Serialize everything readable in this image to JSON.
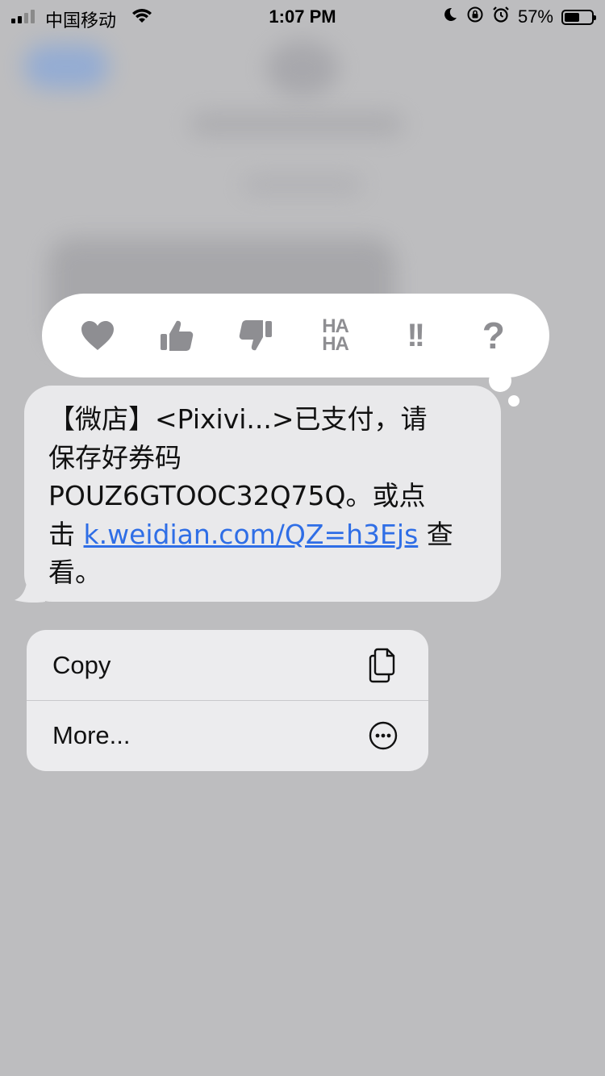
{
  "status_bar": {
    "carrier": "中国移动",
    "time": "1:07 PM",
    "battery_percent": "57%",
    "battery_level": 0.57,
    "signal_bars_active": 2,
    "icons": [
      "wifi-icon",
      "moon-icon",
      "orientation-lock-icon",
      "alarm-icon",
      "battery-icon"
    ]
  },
  "tapback": {
    "options": [
      {
        "name": "heart",
        "icon": "heart-icon"
      },
      {
        "name": "thumbs-up",
        "icon": "thumbs-up-icon"
      },
      {
        "name": "thumbs-down",
        "icon": "thumbs-down-icon"
      },
      {
        "name": "haha",
        "icon": "haha-icon",
        "text_top": "HA",
        "text_bottom": "HA"
      },
      {
        "name": "emphasize",
        "icon": "double-exclamation-icon",
        "text": "!!"
      },
      {
        "name": "question",
        "icon": "question-mark-icon",
        "text": "?"
      }
    ],
    "icon_color": "#8e8e92"
  },
  "message": {
    "line1": "【微店】<Pixivi...>已支付，请",
    "line2": "保存好券码",
    "line3": "POUZ6GTOOC32Q75Q。或点",
    "line4_prefix": "击 ",
    "link": "k.weidian.com/QZ=h3Ejs",
    "line4_suffix": " 查",
    "line5": "看。",
    "link_color": "#2f6ee6"
  },
  "context_menu": {
    "items": [
      {
        "label": "Copy",
        "icon": "copy-icon"
      },
      {
        "label": "More...",
        "icon": "more-ellipsis-icon"
      }
    ]
  }
}
